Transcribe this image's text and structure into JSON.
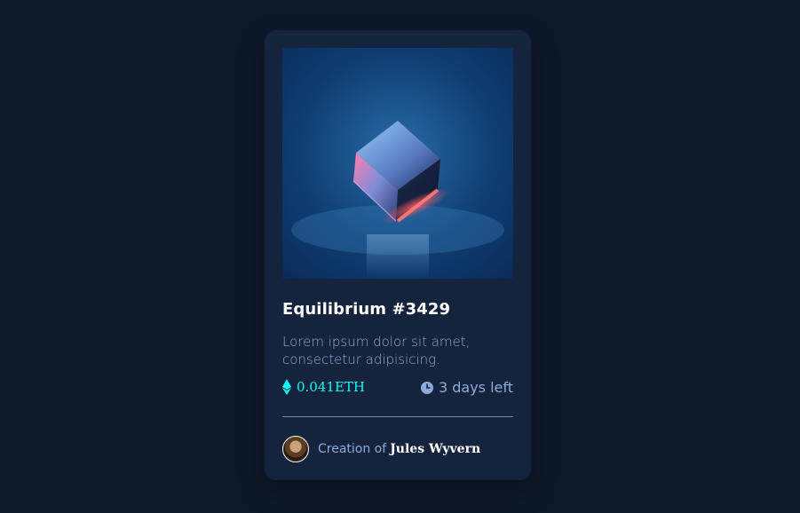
{
  "card": {
    "title": "Equilibrium #3429",
    "description": "Lorem ipsum dolor sit amet, consectetur adipisicing.",
    "price": "0.041ETH",
    "time_left": "3 days left",
    "creator_prefix": "Creation of",
    "creator_name": "Jules Wyvern"
  },
  "colors": {
    "background": "#0d1829",
    "card": "#15233c",
    "accent": "#00fff8",
    "muted": "#8bacd9",
    "text": "#ffffff"
  },
  "icons": {
    "price": "ethereum-icon",
    "time": "clock-icon"
  }
}
